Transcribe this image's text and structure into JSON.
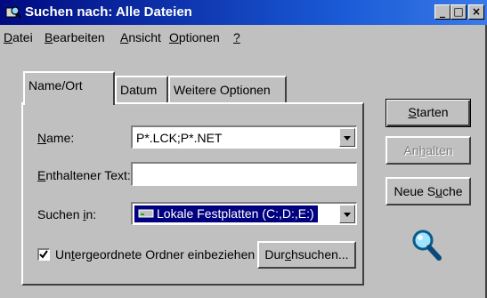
{
  "window": {
    "title": "Suchen nach: Alle Dateien",
    "controls": {
      "minimize": "_",
      "maximize": "□",
      "close": "×"
    }
  },
  "menu": [
    {
      "pre": "",
      "ul": "D",
      "post": "atei"
    },
    {
      "pre": "",
      "ul": "B",
      "post": "earbeiten"
    },
    {
      "pre": "",
      "ul": "A",
      "post": "nsicht"
    },
    {
      "pre": "",
      "ul": "O",
      "post": "ptionen"
    },
    {
      "pre": "",
      "ul": "?",
      "post": ""
    }
  ],
  "tabs": [
    "Name/Ort",
    "Datum",
    "Weitere Optionen"
  ],
  "form": {
    "name_label": {
      "pre": "",
      "ul": "N",
      "post": "ame:"
    },
    "name_value": "P*.LCK;P*.NET",
    "text_label": {
      "pre": "",
      "ul": "E",
      "post": "nthaltener Text:"
    },
    "text_value": "",
    "lookin_label": {
      "pre": "Suchen ",
      "ul": "i",
      "post": "n:"
    },
    "lookin_value": "Lokale Festplatten (C:,D:,E:)",
    "subfolders_label": {
      "pre": "Un",
      "ul": "t",
      "post": "ergeordnete Ordner einbeziehen"
    },
    "subfolders_checked": true,
    "browse_label": {
      "pre": "Dur",
      "ul": "c",
      "post": "hsuchen..."
    }
  },
  "buttons": {
    "start": {
      "pre": "",
      "ul": "S",
      "post": "tarten"
    },
    "stop": {
      "pre": "An",
      "ul": "h",
      "post": "alten"
    },
    "new_search": {
      "pre": "Neue S",
      "ul": "u",
      "post": "che"
    }
  }
}
